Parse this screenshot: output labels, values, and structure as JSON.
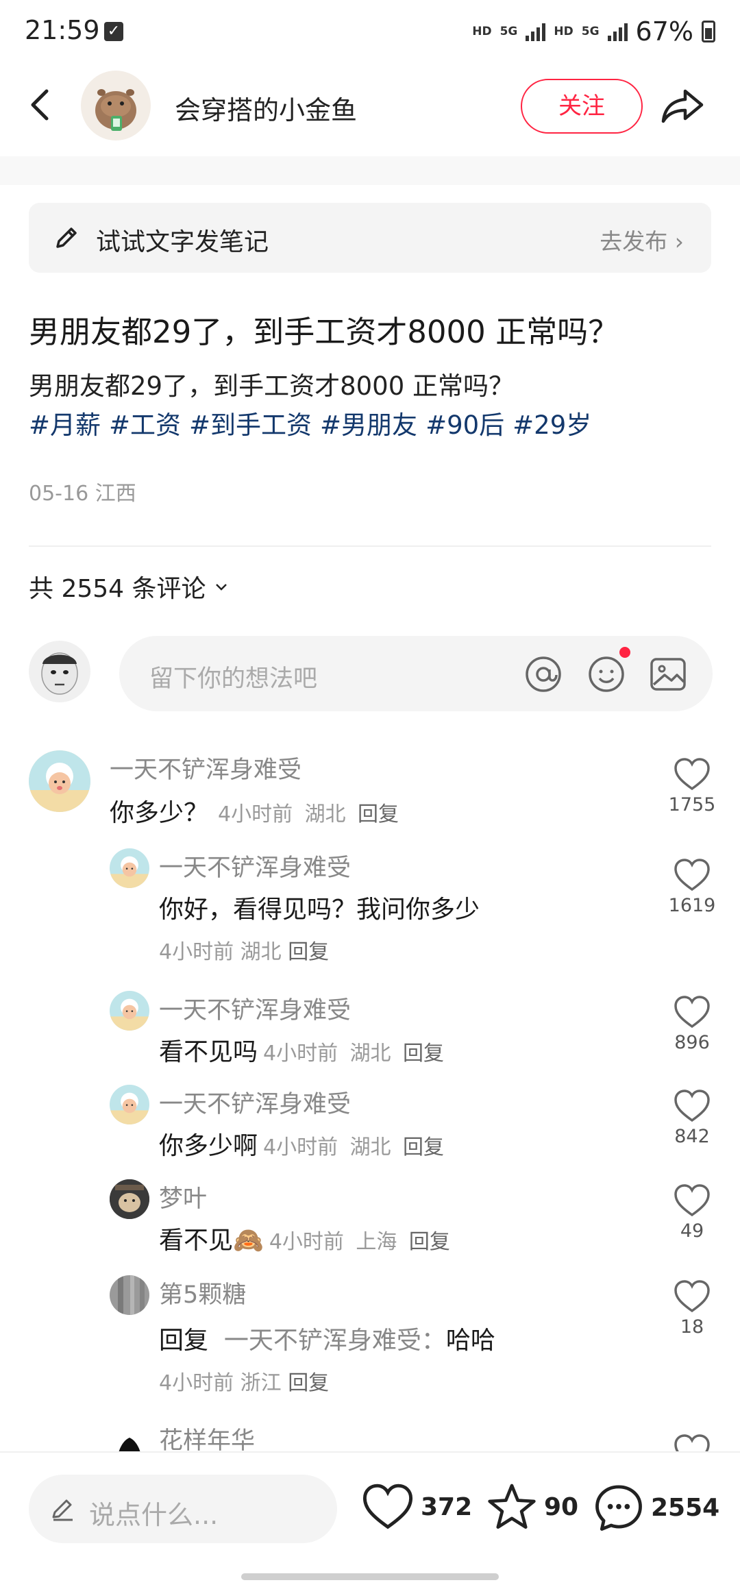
{
  "status_bar": {
    "time": "21:59",
    "hd1": "HD",
    "net1": "5G",
    "hd2": "HD",
    "net2": "5G",
    "battery": "67%"
  },
  "header": {
    "author_name": "会穿搭的小金鱼",
    "follow_label": "关注"
  },
  "publish_prompt": {
    "text": "试试文字发笔记",
    "action": "去发布"
  },
  "note": {
    "title": "男朋友都29了，到手工资才8000 正常吗？",
    "body": "男朋友都29了，到手工资才8000 正常吗？",
    "tags": [
      "#月薪",
      "#工资",
      "#到手工资",
      "#男朋友",
      "#90后",
      "#29岁"
    ],
    "date": "05-16",
    "location": "江西"
  },
  "comments_header": {
    "count_label": "共 2554 条评论"
  },
  "comment_input": {
    "placeholder": "留下你的想法吧"
  },
  "comments": [
    {
      "name": "一天不铲浑身难受",
      "text": "你多少？",
      "time": "4小时前",
      "location": "湖北",
      "reply": "回复",
      "likes": "1755"
    },
    {
      "name": "一天不铲浑身难受",
      "text": "你好，看得见吗？我问你多少",
      "time": "4小时前",
      "location": "湖北",
      "reply": "回复",
      "likes": "1619"
    },
    {
      "name": "一天不铲浑身难受",
      "text": "看不见吗",
      "time": "4小时前",
      "location": "湖北",
      "reply": "回复",
      "likes": "896"
    },
    {
      "name": "一天不铲浑身难受",
      "text": "你多少啊",
      "time": "4小时前",
      "location": "湖北",
      "reply": "回复",
      "likes": "842"
    },
    {
      "name": "梦叶",
      "text": "看不见🙈",
      "time": "4小时前",
      "location": "上海",
      "reply": "回复",
      "likes": "49"
    },
    {
      "name": "第5颗糖",
      "text_prefix": "回复",
      "reply_to": "一天不铲浑身难受：",
      "text": "哈哈",
      "time": "4小时前",
      "location": "浙江",
      "reply": "回复",
      "likes": "18"
    },
    {
      "name": "花样年华"
    }
  ],
  "bottom_bar": {
    "placeholder": "说点什么...",
    "likes": "372",
    "collects": "90",
    "comments": "2554"
  }
}
